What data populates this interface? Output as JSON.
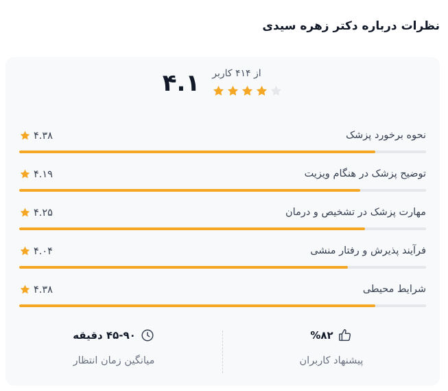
{
  "header": {
    "title": "نظرات درباره دکتر زهره سیدی"
  },
  "summary": {
    "score": "۴.۱",
    "count_text": "از ۴۱۴ کاربر",
    "stars_filled": 4,
    "stars_total": 5
  },
  "ratings": [
    {
      "label": "نحوه برخورد پزشک",
      "score": "۴.۳۸",
      "fraction": 0.876
    },
    {
      "label": "توضیح پزشک در هنگام ویزیت",
      "score": "۴.۱۹",
      "fraction": 0.838
    },
    {
      "label": "مهارت پزشک در تشخیص و درمان",
      "score": "۴.۲۵",
      "fraction": 0.85
    },
    {
      "label": "فرآیند پذیرش و رفتار منشی",
      "score": "۴.۰۴",
      "fraction": 0.808
    },
    {
      "label": "شرایط محیطی",
      "score": "۴.۳۸",
      "fraction": 0.876
    }
  ],
  "stats": {
    "recommend": {
      "value": "%۸۲",
      "label": "پیشنهاد کاربران",
      "icon": "thumbs-up-icon"
    },
    "wait": {
      "value": "۴۵-۹۰ دقیقه",
      "label": "میانگین زمان انتظار",
      "icon": "clock-icon"
    }
  },
  "colors": {
    "star": "#f5a623",
    "star_empty": "#e5e7eb",
    "bar_track": "#e5e7eb"
  }
}
